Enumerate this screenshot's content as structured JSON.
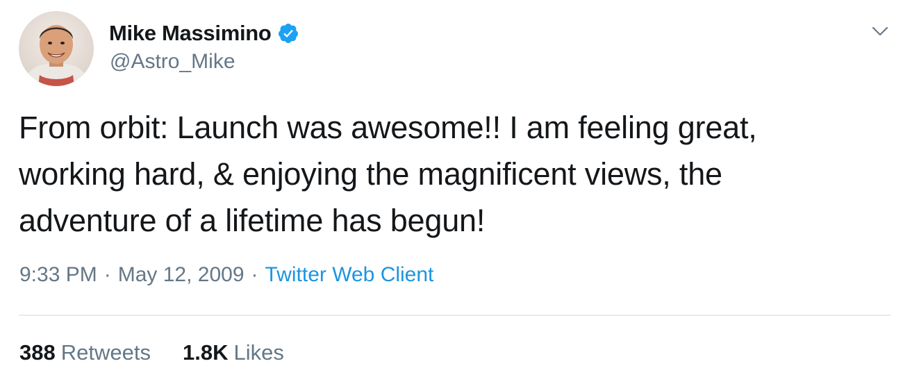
{
  "author": {
    "display_name": "Mike Massimino",
    "handle": "@Astro_Mike",
    "verified": true,
    "avatar_icon": "astronaut-avatar"
  },
  "tweet": {
    "text_lines": [
      "From orbit: Launch was awesome!! I am feeling great,",
      "working hard, & enjoying the magnificent views, the",
      "adventure of a lifetime has begun!"
    ]
  },
  "meta": {
    "time": "9:33 PM",
    "separator": "·",
    "date": "May 12, 2009",
    "source": "Twitter Web Client"
  },
  "stats": {
    "retweets_count": "388",
    "retweets_label": "Retweets",
    "likes_count": "1.8K",
    "likes_label": "Likes"
  },
  "colors": {
    "text": "#14171a",
    "secondary": "#657786",
    "link": "#1b95e0",
    "verified_badge": "#1da1f2",
    "divider": "#e6ecf0"
  },
  "icons": {
    "menu": "chevron-down-icon",
    "verified": "verified-badge-icon"
  }
}
